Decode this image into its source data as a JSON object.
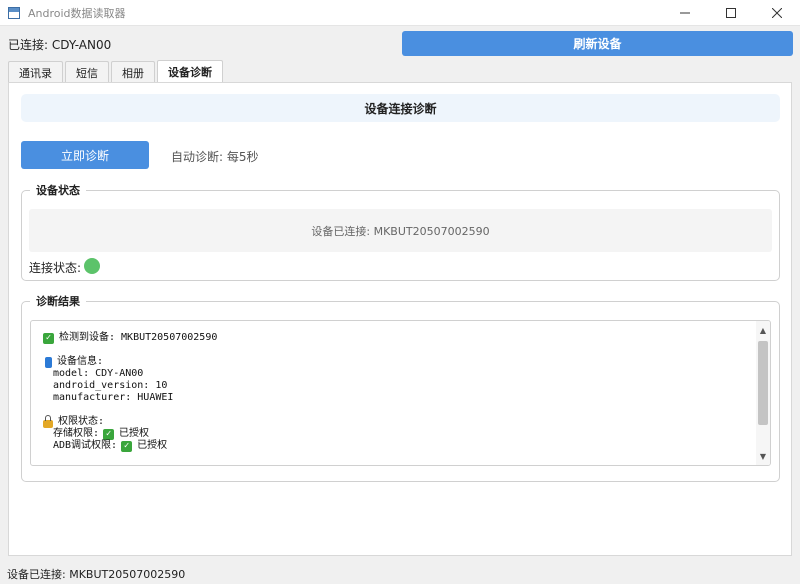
{
  "window": {
    "title": "Android数据读取器",
    "minimize_icon": "minimize-icon",
    "maximize_icon": "maximize-icon",
    "close_icon": "close-icon"
  },
  "header": {
    "connected_text": "已连接: CDY-AN00",
    "refresh_label": "刷新设备"
  },
  "tabs": [
    {
      "label": "通讯录",
      "active": false
    },
    {
      "label": "短信",
      "active": false
    },
    {
      "label": "相册",
      "active": false
    },
    {
      "label": "设备诊断",
      "active": true
    }
  ],
  "diagnostics": {
    "title": "设备连接诊断",
    "diagnose_now_label": "立即诊断",
    "auto_text": "自动诊断: 每5秒"
  },
  "device_status": {
    "group_title": "设备状态",
    "status_text": "设备已连接: MKBUT20507002590",
    "connection_label": "连接状态:",
    "connection_color": "#5cc36a"
  },
  "results": {
    "group_title": "诊断结果",
    "detected": "检测到设备: MKBUT20507002590",
    "device_info_title": "设备信息:",
    "model": "model: CDY-AN00",
    "android_version": "android_version: 10",
    "manufacturer": "manufacturer: HUAWEI",
    "permissions_title": "权限状态:",
    "storage_label": "存储权限:",
    "storage_status": "已授权",
    "adb_label": "ADB调试权限:",
    "adb_status": "已授权"
  },
  "statusbar": {
    "text": "设备已连接: MKBUT20507002590"
  },
  "colors": {
    "accent": "#4a8fe0",
    "success": "#3aa63c"
  }
}
